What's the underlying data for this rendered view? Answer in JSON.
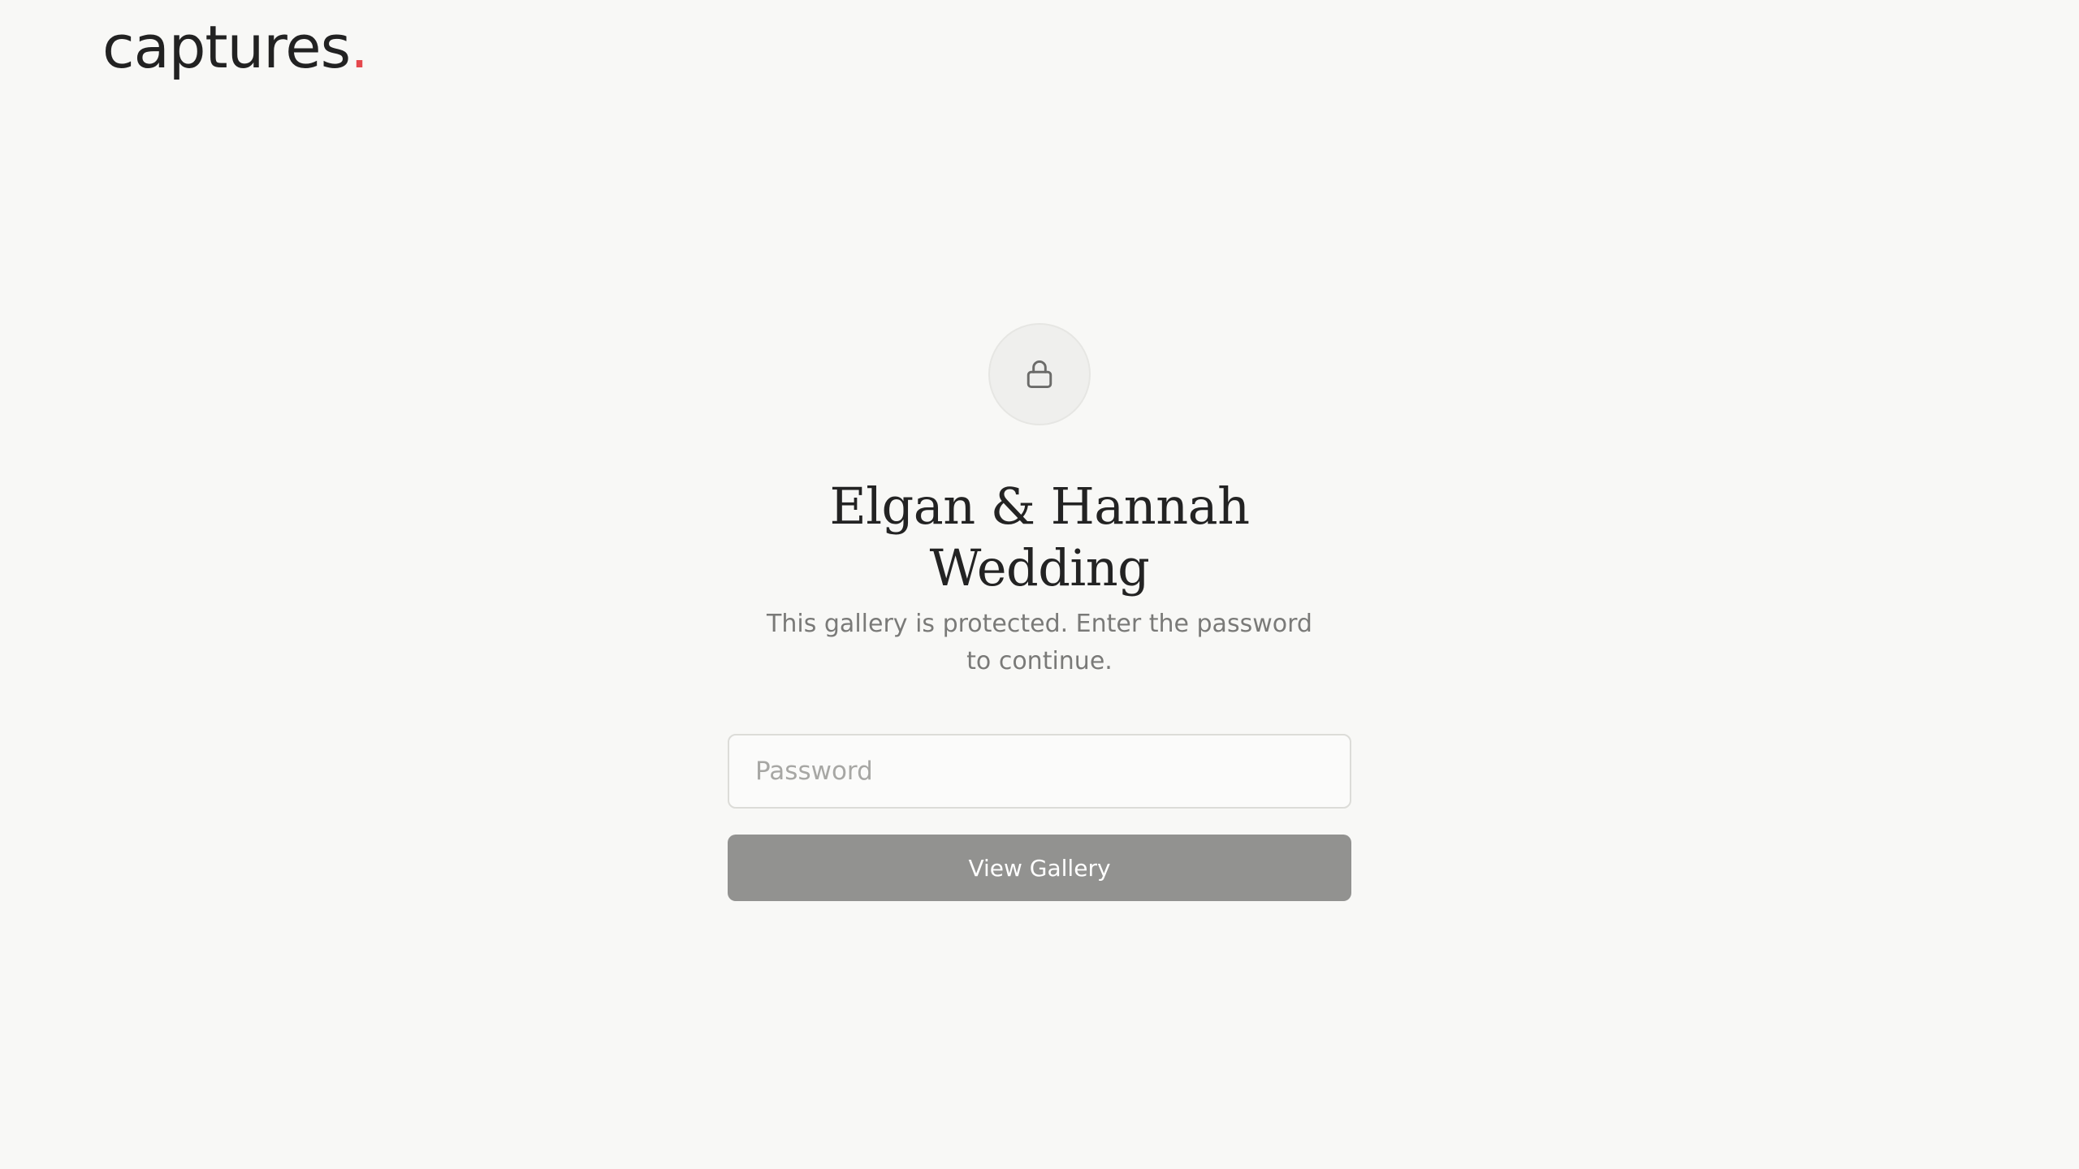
{
  "brand": {
    "name": "captures",
    "dot": ".",
    "accent_color": "#e5484d"
  },
  "gate": {
    "icon": "lock-icon",
    "title": "Elgan & Hannah Wedding",
    "subtitle": "This gallery is protected. Enter the password to continue.",
    "password": {
      "value": "",
      "placeholder": "Password"
    },
    "button_label": "View Gallery",
    "button_color": "#929290"
  }
}
